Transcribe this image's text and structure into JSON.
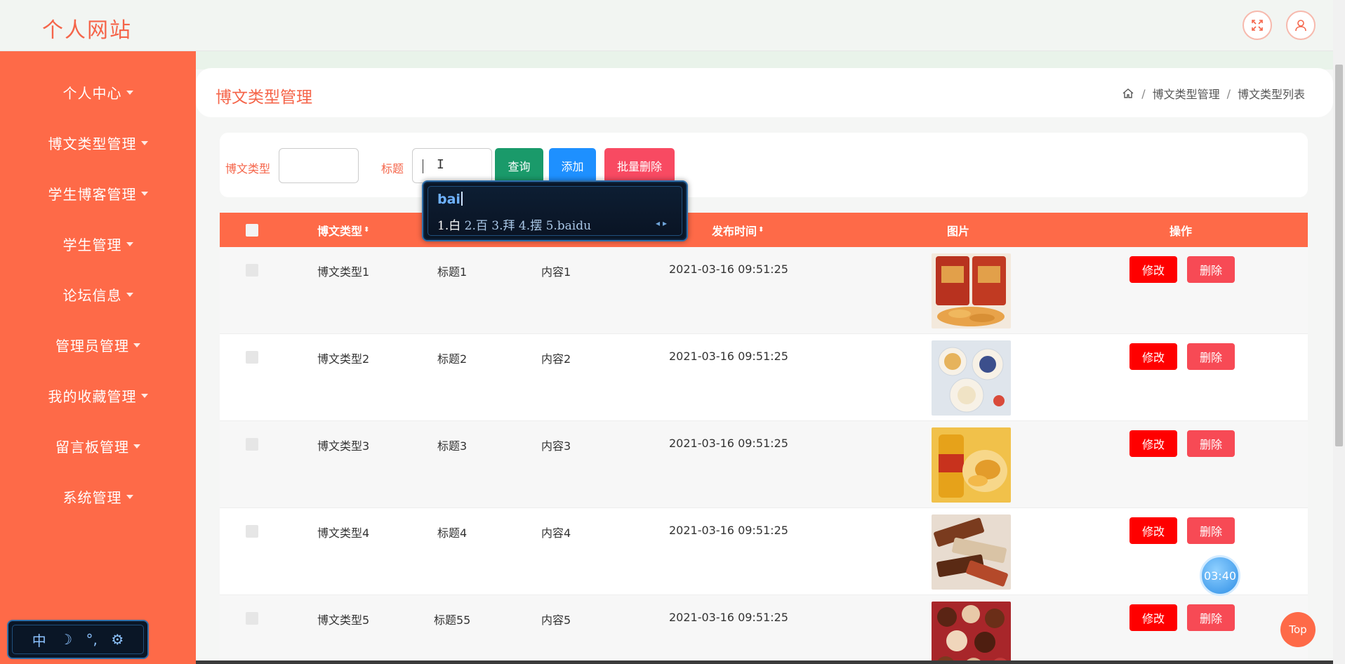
{
  "header": {
    "site_title": "个人网站",
    "fullscreen_icon": "expand-icon",
    "user_icon": "user-icon"
  },
  "sidebar": {
    "items": [
      {
        "label": "个人中心"
      },
      {
        "label": "博文类型管理"
      },
      {
        "label": "学生博客管理"
      },
      {
        "label": "学生管理"
      },
      {
        "label": "论坛信息"
      },
      {
        "label": "管理员管理"
      },
      {
        "label": "我的收藏管理"
      },
      {
        "label": "留言板管理"
      },
      {
        "label": "系统管理"
      }
    ]
  },
  "page": {
    "title": "博文类型管理",
    "breadcrumb": [
      "博文类型管理",
      "博文类型列表"
    ],
    "breadcrumb_sep": "/"
  },
  "search": {
    "type_label": "博文类型",
    "type_value": "",
    "title_label": "标题",
    "title_value": "",
    "query_button": "查询",
    "add_button": "添加",
    "batch_delete_button": "批量删除"
  },
  "table": {
    "headers": {
      "type": "博文类型",
      "publish_time": "发布时间",
      "image": "图片",
      "actions": "操作"
    },
    "sort_glyph": "⬍",
    "edit_label": "修改",
    "delete_label": "删除",
    "rows": [
      {
        "type": "博文类型1",
        "title": "标题1",
        "content": "内容1",
        "time": "2021-03-16 09:51:25"
      },
      {
        "type": "博文类型2",
        "title": "标题2",
        "content": "内容2",
        "time": "2021-03-16 09:51:25"
      },
      {
        "type": "博文类型3",
        "title": "标题3",
        "content": "内容3",
        "time": "2021-03-16 09:51:25"
      },
      {
        "type": "博文类型4",
        "title": "标题4",
        "content": "内容4",
        "time": "2021-03-16 09:51:25"
      },
      {
        "type": "博文类型5",
        "title": "标题55",
        "content": "内容5",
        "time": "2021-03-16 09:51:25"
      }
    ]
  },
  "ime": {
    "composition": "bai",
    "candidates": [
      "1.白",
      "2.百",
      "3.拜",
      "4.摆",
      "5.baidu"
    ],
    "toolbar": [
      "中",
      "☽",
      "°,",
      "⚙"
    ]
  },
  "timer": "03:40",
  "top_button": "Top",
  "colors": {
    "accent": "#fe6a48",
    "title": "#f5654a",
    "query": "#1a9a6a",
    "add": "#1e90ff",
    "batch_delete": "#f84a62",
    "edit": "#ff0000",
    "delete": "#f74a55"
  }
}
